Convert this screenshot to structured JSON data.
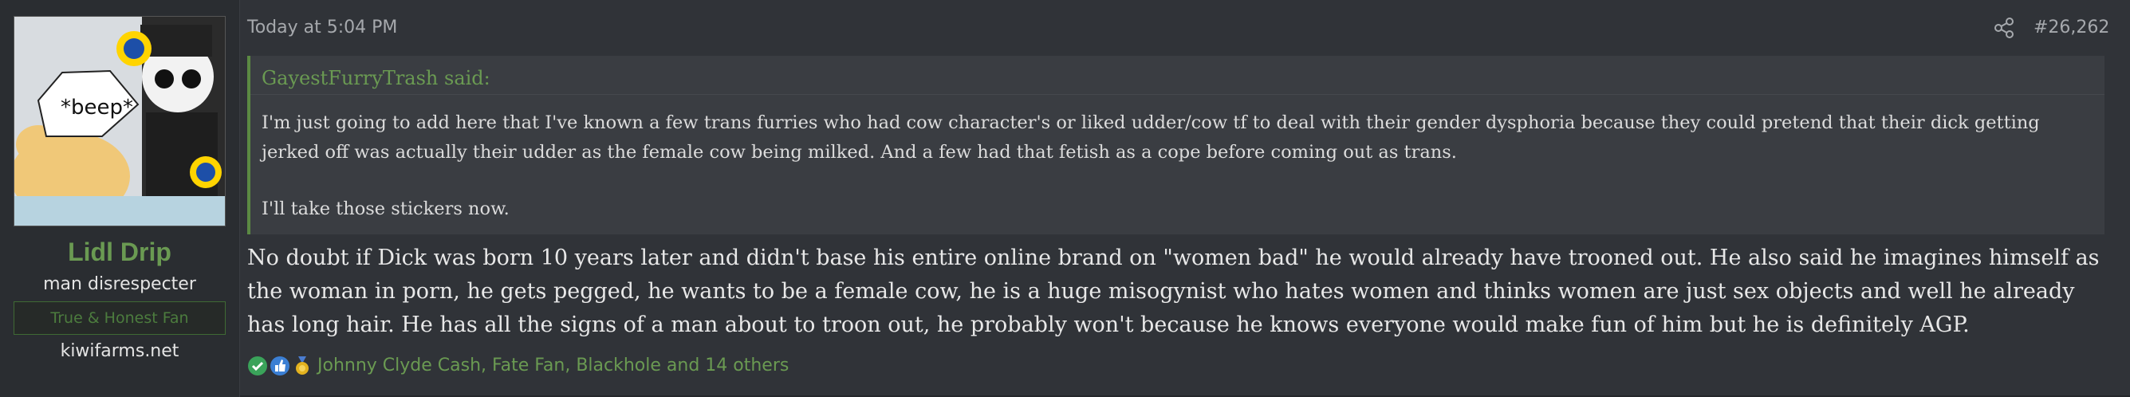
{
  "user": {
    "name": "Lidl Drip",
    "title": "man disrespecter",
    "banner": "True & Honest Fan",
    "site": "kiwifarms.net",
    "avatar_speech": "*beep*"
  },
  "post": {
    "time": "Today at 5:04 PM",
    "number": "#26,262",
    "body": "No doubt if Dick was born 10 years later and didn't base his entire online brand on \"women bad\" he would already have trooned out. He also said he imagines himself as the woman in porn, he gets pegged, he wants to be a female cow, he is a huge misogynist who hates women and thinks women are just sex objects and well he already has long hair. He has all the signs of a man about to troon out, he probably won't because he knows everyone would make fun of him but he is definitely AGP."
  },
  "quote": {
    "author": "GayestFurryTrash said:",
    "paragraphs": [
      "I'm just going to add here that I've known a few trans furries who had cow character's or liked udder/cow tf to deal with their gender dysphoria because they could pretend that their dick getting jerked off was actually their udder as the female cow being milked. And a few had that fetish as a cope before coming out as trans.",
      "I'll take those stickers now."
    ]
  },
  "reactions": {
    "names": "Johnny Clyde Cash, Fate Fan, Blackhole and 14 others",
    "icons": [
      "check-icon",
      "thumbs-up-icon",
      "medal-icon"
    ]
  },
  "colors": {
    "accent_green": "#6a9a52",
    "background": "#303338",
    "quote_bg": "#3a3d42"
  }
}
